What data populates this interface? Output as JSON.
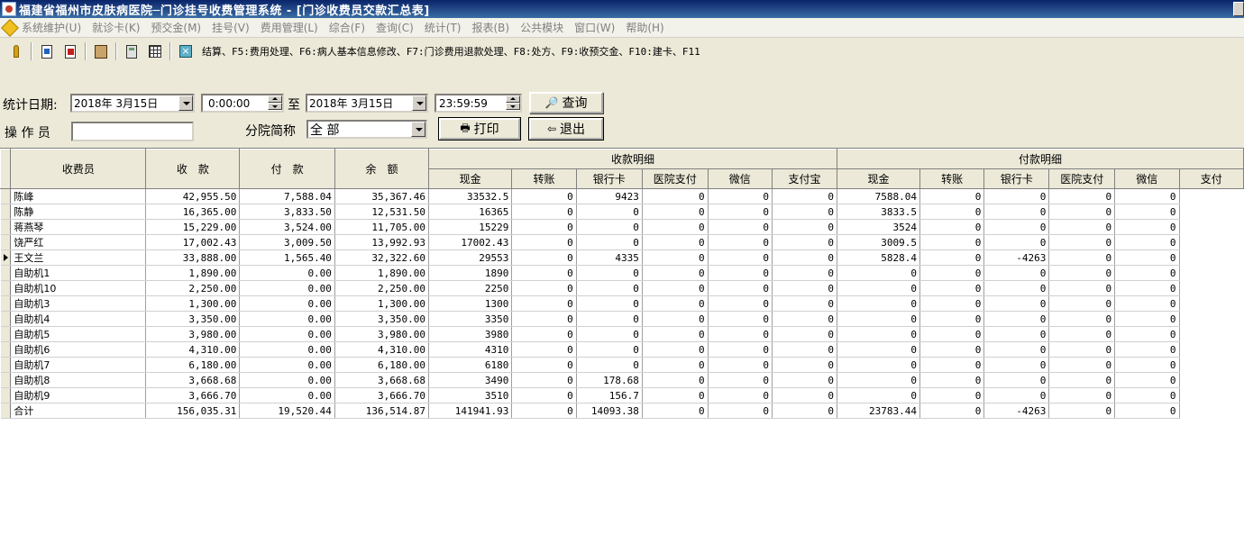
{
  "window": {
    "title": "福建省福州市皮肤病医院─门诊挂号收费管理系统 - [门诊收费员交款汇总表]"
  },
  "menu": {
    "items": [
      "系统维护(U)",
      "就诊卡(K)",
      "预交金(M)",
      "挂号(V)",
      "费用管理(L)",
      "综合(F)",
      "查询(C)",
      "统计(T)",
      "报表(B)",
      "公共模块",
      "窗口(W)",
      "帮助(H)"
    ]
  },
  "toolbar": {
    "icons": [
      "key-icon",
      "document-import-icon",
      "document-delete-icon",
      "book-icon",
      "calculator-icon",
      "grid-icon",
      "close-square-icon"
    ],
    "hint": "结算、F5:费用处理、F6:病人基本信息修改、F7:门诊费用退款处理、F8:处方、F9:收预交金、F10:建卡、F11"
  },
  "query": {
    "date_label": "统计日期:",
    "start_date": "2018年  3月15日",
    "start_time": "0:00:00",
    "to_label": "至",
    "end_date": "2018年  3月15日",
    "end_time": "23:59:59",
    "search_label": "查询",
    "operator_label": "操 作 员",
    "operator_value": "",
    "branch_label": "分院简称",
    "branch_value": "全 部",
    "print_label": "打印",
    "exit_label": "退出"
  },
  "grid": {
    "group_receive": "收款明细",
    "group_pay": "付款明细",
    "main_headers": [
      "收费员",
      "收　款",
      "付　款",
      "余　额"
    ],
    "sub_headers_receive": [
      "现金",
      "转账",
      "银行卡",
      "医院支付",
      "微信",
      "支付宝"
    ],
    "sub_headers_pay": [
      "现金",
      "转账",
      "银行卡",
      "医院支付",
      "微信",
      "支付"
    ],
    "current_row": 4,
    "rows": [
      [
        "陈峰",
        "42,955.50",
        "7,588.04",
        "35,367.46",
        "33532.5",
        "0",
        "9423",
        "0",
        "0",
        "0",
        "7588.04",
        "0",
        "0",
        "0",
        "0"
      ],
      [
        "陈静",
        "16,365.00",
        "3,833.50",
        "12,531.50",
        "16365",
        "0",
        "0",
        "0",
        "0",
        "0",
        "3833.5",
        "0",
        "0",
        "0",
        "0"
      ],
      [
        "蒋燕琴",
        "15,229.00",
        "3,524.00",
        "11,705.00",
        "15229",
        "0",
        "0",
        "0",
        "0",
        "0",
        "3524",
        "0",
        "0",
        "0",
        "0"
      ],
      [
        "饶严红",
        "17,002.43",
        "3,009.50",
        "13,992.93",
        "17002.43",
        "0",
        "0",
        "0",
        "0",
        "0",
        "3009.5",
        "0",
        "0",
        "0",
        "0"
      ],
      [
        "王文兰",
        "33,888.00",
        "1,565.40",
        "32,322.60",
        "29553",
        "0",
        "4335",
        "0",
        "0",
        "0",
        "5828.4",
        "0",
        "-4263",
        "0",
        "0"
      ],
      [
        "自助机1",
        "1,890.00",
        "0.00",
        "1,890.00",
        "1890",
        "0",
        "0",
        "0",
        "0",
        "0",
        "0",
        "0",
        "0",
        "0",
        "0"
      ],
      [
        "自助机10",
        "2,250.00",
        "0.00",
        "2,250.00",
        "2250",
        "0",
        "0",
        "0",
        "0",
        "0",
        "0",
        "0",
        "0",
        "0",
        "0"
      ],
      [
        "自助机3",
        "1,300.00",
        "0.00",
        "1,300.00",
        "1300",
        "0",
        "0",
        "0",
        "0",
        "0",
        "0",
        "0",
        "0",
        "0",
        "0"
      ],
      [
        "自助机4",
        "3,350.00",
        "0.00",
        "3,350.00",
        "3350",
        "0",
        "0",
        "0",
        "0",
        "0",
        "0",
        "0",
        "0",
        "0",
        "0"
      ],
      [
        "自助机5",
        "3,980.00",
        "0.00",
        "3,980.00",
        "3980",
        "0",
        "0",
        "0",
        "0",
        "0",
        "0",
        "0",
        "0",
        "0",
        "0"
      ],
      [
        "自助机6",
        "4,310.00",
        "0.00",
        "4,310.00",
        "4310",
        "0",
        "0",
        "0",
        "0",
        "0",
        "0",
        "0",
        "0",
        "0",
        "0"
      ],
      [
        "自助机7",
        "6,180.00",
        "0.00",
        "6,180.00",
        "6180",
        "0",
        "0",
        "0",
        "0",
        "0",
        "0",
        "0",
        "0",
        "0",
        "0"
      ],
      [
        "自助机8",
        "3,668.68",
        "0.00",
        "3,668.68",
        "3490",
        "0",
        "178.68",
        "0",
        "0",
        "0",
        "0",
        "0",
        "0",
        "0",
        "0"
      ],
      [
        "自助机9",
        "3,666.70",
        "0.00",
        "3,666.70",
        "3510",
        "0",
        "156.7",
        "0",
        "0",
        "0",
        "0",
        "0",
        "0",
        "0",
        "0"
      ],
      [
        " 合计",
        "156,035.31",
        "19,520.44",
        "136,514.87",
        "141941.93",
        "0",
        "14093.38",
        "0",
        "0",
        "0",
        "23783.44",
        "0",
        "-4263",
        "0",
        "0"
      ]
    ]
  }
}
